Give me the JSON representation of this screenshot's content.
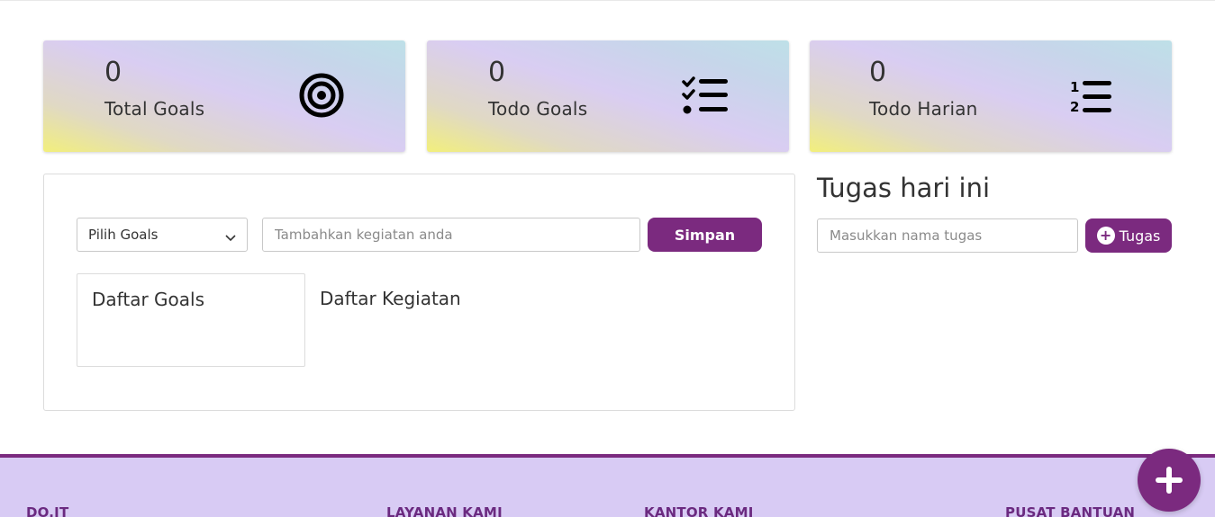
{
  "stats": [
    {
      "count": "0",
      "label": "Total Goals",
      "icon": "target-icon"
    },
    {
      "count": "0",
      "label": "Todo Goals",
      "icon": "checklist-icon"
    },
    {
      "count": "0",
      "label": "Todo Harian",
      "icon": "numbered-list-icon"
    }
  ],
  "activity_form": {
    "select_value": "Pilih Goals",
    "input_placeholder": "Tambahkan kegiatan anda",
    "save_label": "Simpan"
  },
  "goals_list": {
    "title": "Daftar Goals"
  },
  "activity_list": {
    "title": "Daftar Kegiatan"
  },
  "tasks": {
    "title": "Tugas hari ini",
    "input_placeholder": "Masukkan nama tugas",
    "add_label": "Tugas"
  },
  "footer": {
    "columns": [
      "DO.IT",
      "LAYANAN KAMI",
      "KANTOR KAMI",
      "PUSAT BANTUAN"
    ]
  },
  "fab": {
    "icon": "plus-icon"
  },
  "colors": {
    "primary": "#7b2a7f",
    "footer_bg": "#d8cbf4"
  }
}
